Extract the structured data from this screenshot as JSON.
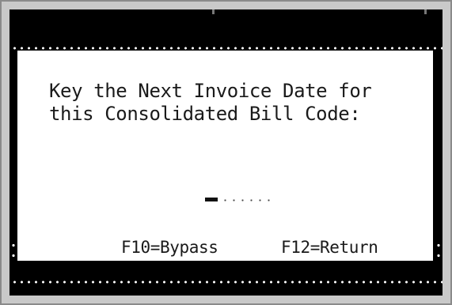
{
  "dialog": {
    "prompt_line1": "Key the Next Invoice Date for",
    "prompt_line2": "this Consolidated Bill Code:"
  },
  "date_input": {
    "value": ""
  },
  "function_keys": {
    "bypass_label": "F10=Bypass",
    "return_label": "F12=Return"
  },
  "colors": {
    "screen_background": "#000000",
    "panel_background": "#ffffff",
    "text": "#1a1a1a",
    "frame": "#c9c9c9"
  }
}
